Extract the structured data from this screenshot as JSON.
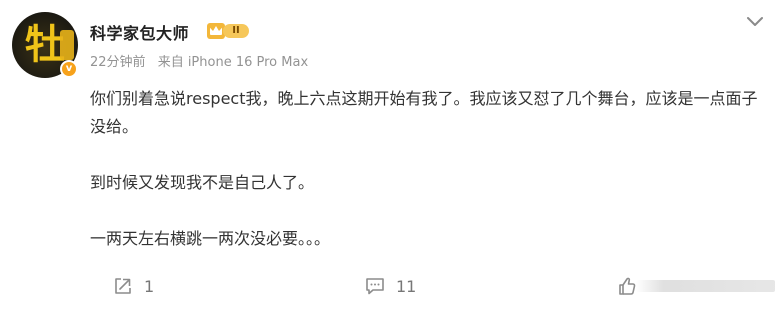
{
  "post": {
    "username": "科学家包大师",
    "member_level": "II",
    "timestamp": "22分钟前",
    "source": "来自 iPhone 16 Pro Max",
    "paragraphs": [
      "你们别着急说respect我，晚上六点这期开始有我了。我应该又怼了几个舞台，应该是一点面子没给。",
      "到时候又发现我不是自己人了。",
      "一两天左右横跳一两次没必要。。。"
    ]
  },
  "actions": {
    "share_count": "1",
    "comment_count": "11",
    "like_count": ""
  },
  "icons": {
    "verified": "v-badge-icon",
    "member": "crown-icon",
    "menu": "chevron-down-icon",
    "share": "share-icon",
    "comment": "comment-icon",
    "like": "thumbs-up-icon"
  },
  "colors": {
    "verified_badge": "#f7a21b",
    "member_badge": "#f6c75a",
    "meta_text": "#939393",
    "action_text": "#777777"
  }
}
